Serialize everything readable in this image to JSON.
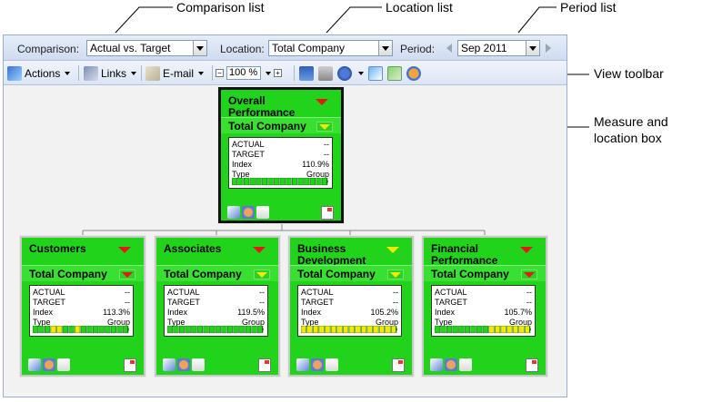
{
  "callouts": {
    "comparison": "Comparison list",
    "location": "Location list",
    "period": "Period list",
    "view_toolbar": "View toolbar",
    "measure_box_1": "Measure and",
    "measure_box_2": "location box"
  },
  "filters": {
    "comparison_label": "Comparison:",
    "comparison_value": "Actual vs. Target",
    "location_label": "Location:",
    "location_value": "Total Company",
    "period_label": "Period:",
    "period_value": "Sep 2011"
  },
  "toolbar": {
    "actions": "Actions",
    "links": "Links",
    "email": "E-mail",
    "zoom": "100 %",
    "zoom_minus": "−",
    "zoom_plus": "+"
  },
  "colors": {
    "card_green": "#22d31c",
    "status_red": "#e41818",
    "status_yellow": "#f3e800"
  },
  "cards": [
    {
      "title": "Overall Performance",
      "location": "Total Company",
      "status": "red",
      "location_status": "yellow",
      "actual_label": "ACTUAL",
      "actual": "--",
      "target_label": "TARGET",
      "target": "--",
      "index_label": "Index",
      "index": "110.9%",
      "type_label": "Type",
      "type": "Group",
      "gauge": "green"
    },
    {
      "title": "Customers",
      "location": "Total Company",
      "status": "red",
      "location_status": "red",
      "actual_label": "ACTUAL",
      "actual": "--",
      "target_label": "TARGET",
      "target": "--",
      "index_label": "Index",
      "index": "113.3%",
      "type_label": "Type",
      "type": "Group",
      "gauge": "mixed"
    },
    {
      "title": "Associates",
      "location": "Total Company",
      "status": "red",
      "location_status": "yellow",
      "actual_label": "ACTUAL",
      "actual": "--",
      "target_label": "TARGET",
      "target": "--",
      "index_label": "Index",
      "index": "119.5%",
      "type_label": "Type",
      "type": "Group",
      "gauge": "green"
    },
    {
      "title": "Business Development",
      "location": "Total Company",
      "status": "yellow",
      "location_status": "yellow",
      "actual_label": "ACTUAL",
      "actual": "--",
      "target_label": "TARGET",
      "target": "--",
      "index_label": "Index",
      "index": "105.2%",
      "type_label": "Type",
      "type": "Group",
      "gauge": "yellow"
    },
    {
      "title": "Financial Performance",
      "location": "Total Company",
      "status": "red",
      "location_status": "red",
      "actual_label": "ACTUAL",
      "actual": "--",
      "target_label": "TARGET",
      "target": "--",
      "index_label": "Index",
      "index": "105.7%",
      "type_label": "Type",
      "type": "Group",
      "gauge": "green-yellow"
    }
  ]
}
